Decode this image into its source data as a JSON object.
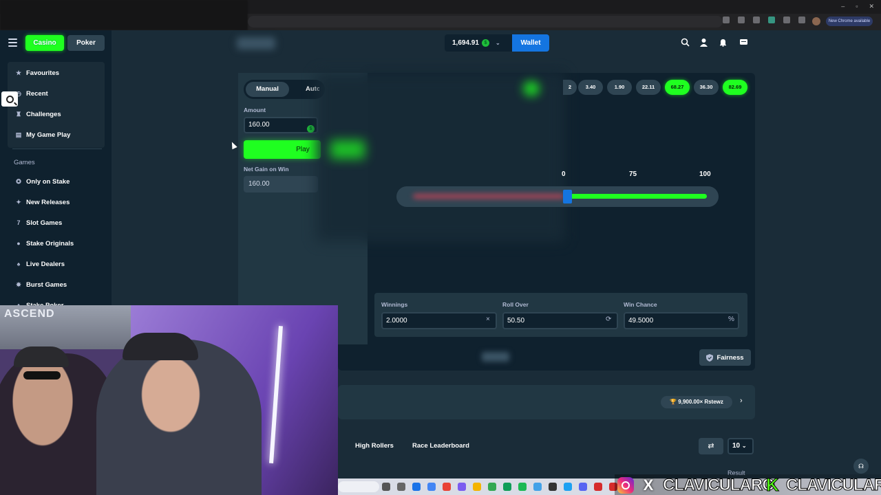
{
  "browser": {
    "update_label": "New Chrome available",
    "window_controls": [
      "–",
      "▫",
      "✕"
    ]
  },
  "header": {
    "casino_label": "Casino",
    "poker_label": "Poker",
    "balance": "1,694.91",
    "currency_symbol": "$",
    "wallet_label": "Wallet",
    "icons": [
      "search-icon",
      "user-icon",
      "bell-icon",
      "chat-icon"
    ]
  },
  "sidebar": {
    "items_top": [
      {
        "label": "Favourites",
        "icon": "star-icon"
      },
      {
        "label": "Recent",
        "icon": "clock-icon"
      },
      {
        "label": "Challenges",
        "icon": "trophy-icon"
      },
      {
        "label": "My Game Play",
        "icon": "list-icon"
      }
    ],
    "games_heading": "Games",
    "items_games": [
      {
        "label": "Only on Stake",
        "icon": "badge-icon"
      },
      {
        "label": "New Releases",
        "icon": "sparkle-icon"
      },
      {
        "label": "Slot Games",
        "icon": "slot-icon"
      },
      {
        "label": "Stake Originals",
        "icon": "flame-icon"
      },
      {
        "label": "Live Dealers",
        "icon": "cards-icon"
      },
      {
        "label": "Burst Games",
        "icon": "burst-icon"
      },
      {
        "label": "Stake Poker",
        "icon": "poker-icon"
      }
    ]
  },
  "controls": {
    "tab_manual": "Manual",
    "tab_auto": "Auto",
    "amount_label": "Amount",
    "amount_value": "160.00",
    "play_label": "Play",
    "net_gain_label": "Net Gain on Win",
    "net_gain_value": "160.00"
  },
  "recent_results": [
    {
      "value": "2",
      "win": false
    },
    {
      "value": "3.40",
      "win": false
    },
    {
      "value": "1.90",
      "win": false
    },
    {
      "value": "22.11",
      "win": false
    },
    {
      "value": "68.27",
      "win": true
    },
    {
      "value": "36.30",
      "win": false
    },
    {
      "value": "82.69",
      "win": true
    }
  ],
  "slider": {
    "labels": [
      "0",
      "75",
      "100"
    ],
    "roll_over": 50.5
  },
  "stats": {
    "winnings_label": "Winnings",
    "winnings_value": "2.0000",
    "winnings_suffix": "×",
    "roll_over_label": "Roll Over",
    "roll_over_value": "50.50",
    "roll_over_suffix": "⟳",
    "win_chance_label": "Win Chance",
    "win_chance_value": "49.5000",
    "win_chance_suffix": "%"
  },
  "footer": {
    "fairness_label": "Fairness",
    "big_win": "9,900.00× Rstewz",
    "leaderboard_tabs": [
      "High Rollers",
      "Race Leaderboard"
    ],
    "rows_select": "10",
    "result_header": "Result"
  },
  "webcam": {
    "banner_text": "ASCEND"
  },
  "social": {
    "handle_1": "CLAVICULARO",
    "handle_2": "CLAVICULAR",
    "kick_letter": "K",
    "x_letter": "X"
  }
}
